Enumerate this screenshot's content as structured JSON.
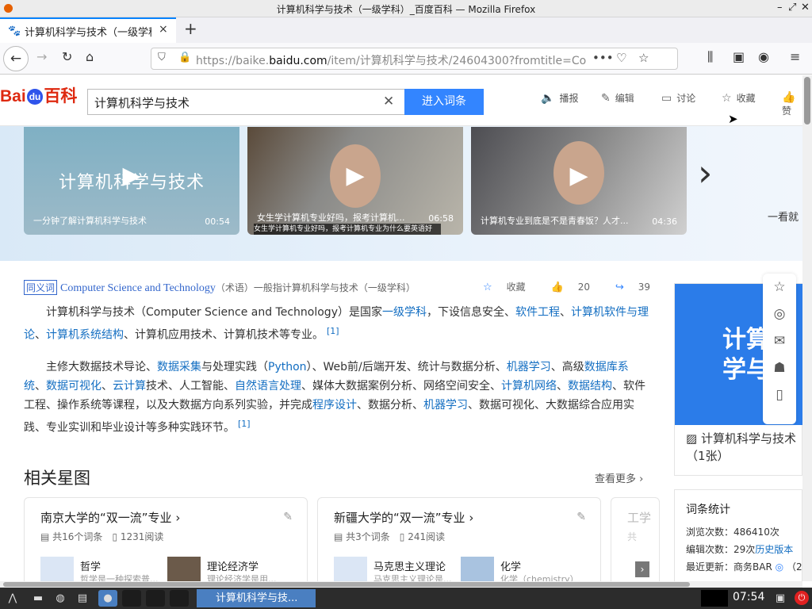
{
  "window": {
    "title": "计算机科学与技术（一级学科）_百度百科 — Mozilla Firefox"
  },
  "tab": {
    "label": "计算机科学与技术（一级学科）_百度百科",
    "close": "×",
    "new": "+"
  },
  "url": {
    "prefix": "https://baike.",
    "host": "baidu.com",
    "path": "/item/计算机科学与技术/24604300?fromtitle=Co"
  },
  "header": {
    "logo_bai": "Bai",
    "logo_du": "du",
    "logo_baike": "百科",
    "search_value": "计算机科学与技术",
    "enter_label": "进入词条",
    "tools": [
      "播报",
      "编辑",
      "讨论",
      "收藏",
      "赞"
    ]
  },
  "videos": [
    {
      "big": "计算机科学与技术",
      "caption": "一分钟了解计算机科学与技术",
      "duration": "00:54"
    },
    {
      "caption": "女生学计算机专业好吗，报考计算机...",
      "duration": "06:58",
      "subtitle": "女生学计算机专业好吗，报考计算机专业为什么要英语好"
    },
    {
      "caption": "计算机专业到底是不是青春饭？人才...",
      "duration": "04:36"
    }
  ],
  "banner_side": "一看就",
  "synonym": {
    "tag": "同义词",
    "en": "Computer Science and Technology",
    "note": "（术语）一般指计算机科学与技术（一级学科）"
  },
  "stats": {
    "collect": "收藏",
    "likes": "20",
    "shares": "39"
  },
  "para1": {
    "t1": "计算机科学与技术（Computer Science and Technology）是国家",
    "l1": "一级学科",
    "t2": "，下设信息安全、",
    "l2": "软件工程",
    "t3": "、",
    "l3": "计算机软件与理论",
    "t4": "、",
    "l4": "计算机系统结构",
    "t5": "、计算机应用技术、计算机技术等专业。",
    "ref": "[1]"
  },
  "para2": {
    "t1": "主修大数据技术导论、",
    "l1": "数据采集",
    "t2": "与处理实践（",
    "l2": "Python",
    "t3": "）、Web前/后端开发、统计与数据分析、",
    "l3": "机器学习",
    "t4": "、高级",
    "l4": "数据库系统",
    "t5": "、",
    "l5": "数据可视化",
    "t6": "、",
    "l6": "云计算",
    "t7": "技术、人工智能、",
    "l7": "自然语言处理",
    "t8": "、媒体大数据案例分析、网络空间安全、",
    "l8": "计算机网络",
    "t9": "、",
    "l9": "数据结构",
    "t10": "、软件工程、操作系统等课程，以及大数据方向系列实验，并完成",
    "l10": "程序设计",
    "t11": "、数据分析、",
    "l11": "机器学习",
    "t12": "、数据可视化、大数据综合应用实践、专业实训和毕业设计等多种实践环节。",
    "ref": "[1]"
  },
  "related": {
    "title": "相关星图",
    "more": "查看更多"
  },
  "cards": [
    {
      "title": "南京大学的“双一流”专业",
      "count": "共16个词条",
      "reads": "1231阅读",
      "items": [
        {
          "name": "哲学",
          "desc": "哲学是一种探索普..."
        },
        {
          "name": "理论经济学",
          "desc": "理论经济学是用..."
        }
      ]
    },
    {
      "title": "新疆大学的“双一流”专业",
      "count": "共3个词条",
      "reads": "241阅读",
      "items": [
        {
          "name": "马克思主义理论",
          "desc": "马克思主义理论是..."
        },
        {
          "name": "化学",
          "desc": "化学（chemistry）..."
        }
      ]
    },
    {
      "title": "工学",
      "count": "共"
    }
  ],
  "rightpanel": {
    "img_text_line1": "计算",
    "img_text_line2": "学与",
    "caption": "计算机科学与技术（1张）"
  },
  "stat": {
    "title": "词条统计",
    "views_label": "浏览次数：",
    "views": "486410次",
    "edits_label": "编辑次数：",
    "edits": "29次",
    "history": "历史版本",
    "updated_label": "最近更新：",
    "updated_by": "商务BAR",
    "updated_tail": "（2"
  },
  "taskbar": {
    "task_label": "计算机科学与技...",
    "clock": "07:54"
  }
}
